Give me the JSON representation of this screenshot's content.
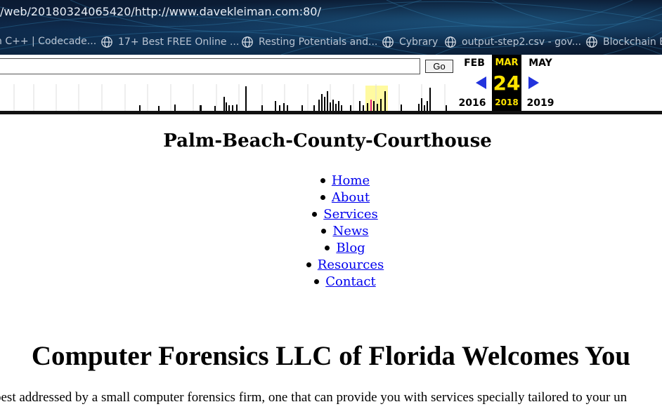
{
  "browser": {
    "url": "/web/20180324065420/http://www.davekleiman.com:80/",
    "bookmarks": [
      {
        "label": "n C++ | Codecade...",
        "icon": "none"
      },
      {
        "label": "17+ Best FREE Online ...",
        "icon": "globe-icon"
      },
      {
        "label": "Resting Potentials and...",
        "icon": "globe-icon"
      },
      {
        "label": "Cybrary",
        "icon": "globe-icon"
      },
      {
        "label": "output-step2.csv - gov...",
        "icon": "globe-icon"
      },
      {
        "label": "Blockchain E",
        "icon": "globe-icon"
      }
    ]
  },
  "wayback": {
    "url_value": "",
    "go_label": "Go",
    "prev": {
      "month": "FEB",
      "year": "2016"
    },
    "current": {
      "month": "MAR",
      "day": "24",
      "year": "2018"
    },
    "next": {
      "month": "MAY",
      "year": "2019"
    },
    "highlight_color": "#ffe400",
    "arrow_color": "#2233dd"
  },
  "page": {
    "site_title": "Palm-Beach-County-Courthouse",
    "nav": [
      {
        "label": "Home"
      },
      {
        "label": "About"
      },
      {
        "label": "Services"
      },
      {
        "label": "News"
      },
      {
        "label": "Blog"
      },
      {
        "label": "Resources"
      },
      {
        "label": "Contact"
      }
    ],
    "heading": "Computer Forensics LLC of Florida Welcomes You",
    "intro_text": "best addressed by a small computer forensics firm, one that can provide you with services specially tailored to your un",
    "link_color": "#0000ee"
  }
}
